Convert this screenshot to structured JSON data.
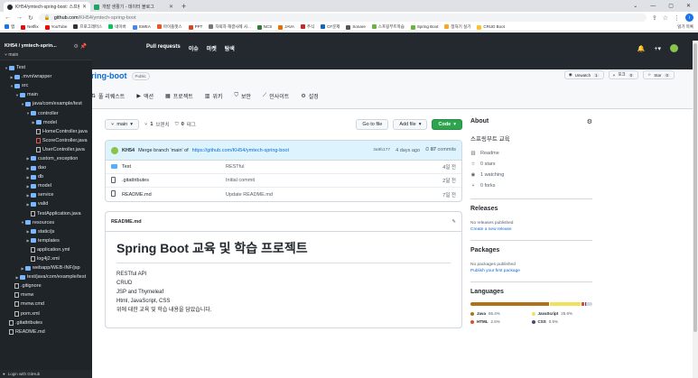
{
  "browser": {
    "tabs": [
      {
        "title": "KH54/ymtech-spring-boot: 스프링...",
        "active": true,
        "icon": "github-icon"
      },
      {
        "title": "개발 생활기 - 데이터 블로그",
        "active": false,
        "icon": "blog-icon"
      }
    ],
    "url_host": "github.com",
    "url_path": "/KH54/ymtech-spring-boot",
    "profile_initial": "i",
    "bookmarks": [
      "앱",
      "Netflix",
      "YouTube",
      "프로그래머스",
      "네이버",
      "SWEA",
      "마이플랫스",
      "PPT",
      "자퇴자 해결사례 사...",
      "NCS",
      "JAVA",
      "주식",
      "CF문제",
      "Sonare",
      "스프링부트학습",
      "Spring Boot",
      "정처기 실기",
      "CRUD Boot"
    ],
    "bookmarks_right": "읽기 목록"
  },
  "github": {
    "nav": [
      "Pull requests",
      "이슈",
      "마켓",
      "탐색"
    ],
    "repo_name": "ring-boot",
    "visibility": "Public",
    "watch": {
      "label": "Unwatch",
      "count": "1"
    },
    "fork": {
      "label": "포크",
      "count": "0"
    },
    "star": {
      "label": "Star",
      "count": "0"
    },
    "tabs": [
      "풀 리퀘스트",
      "액션",
      "프로젝트",
      "위키",
      "보안",
      "인사이트",
      "설정"
    ]
  },
  "sidebar": {
    "repo": "KH54 / ymtech-sprin...",
    "branch": "main",
    "footer": "Login with GitHub",
    "tree": [
      {
        "name": "Test",
        "depth": 0,
        "type": "folder",
        "open": true
      },
      {
        "name": ".mvn/wrapper",
        "depth": 1,
        "type": "folder",
        "open": false
      },
      {
        "name": "src",
        "depth": 1,
        "type": "folder",
        "open": true
      },
      {
        "name": "main",
        "depth": 2,
        "type": "folder",
        "open": true
      },
      {
        "name": "java/com/example/test",
        "depth": 3,
        "type": "folder",
        "open": true
      },
      {
        "name": "controller",
        "depth": 4,
        "type": "folder",
        "open": true
      },
      {
        "name": "model",
        "depth": 5,
        "type": "folder",
        "open": false
      },
      {
        "name": "HomeController.java",
        "depth": 5,
        "type": "file"
      },
      {
        "name": "ScoreController.java",
        "depth": 5,
        "type": "ctl"
      },
      {
        "name": "UserController.java",
        "depth": 5,
        "type": "file"
      },
      {
        "name": "custom_exception",
        "depth": 4,
        "type": "folder",
        "open": false
      },
      {
        "name": "dao",
        "depth": 4,
        "type": "folder",
        "open": false
      },
      {
        "name": "db",
        "depth": 4,
        "type": "folder",
        "open": false
      },
      {
        "name": "model",
        "depth": 4,
        "type": "folder",
        "open": false
      },
      {
        "name": "service",
        "depth": 4,
        "type": "folder",
        "open": false
      },
      {
        "name": "valid",
        "depth": 4,
        "type": "folder",
        "open": false
      },
      {
        "name": "TestApplication.java",
        "depth": 4,
        "type": "file"
      },
      {
        "name": "resources",
        "depth": 3,
        "type": "folder",
        "open": true
      },
      {
        "name": "static/js",
        "depth": 4,
        "type": "folder",
        "open": false
      },
      {
        "name": "templates",
        "depth": 4,
        "type": "folder",
        "open": false
      },
      {
        "name": "application.yml",
        "depth": 4,
        "type": "file"
      },
      {
        "name": "log4j2.xml",
        "depth": 4,
        "type": "file"
      },
      {
        "name": "webapp/WEB-INF/jsp",
        "depth": 3,
        "type": "folder",
        "open": false
      },
      {
        "name": "test/java/com/example/test",
        "depth": 2,
        "type": "folder",
        "open": false
      },
      {
        "name": ".gitignore",
        "depth": 1,
        "type": "file"
      },
      {
        "name": "mvnw",
        "depth": 1,
        "type": "file"
      },
      {
        "name": "mvnw.cmd",
        "depth": 1,
        "type": "file"
      },
      {
        "name": "pom.xml",
        "depth": 1,
        "type": "file"
      },
      {
        "name": ".gitattributes",
        "depth": 0,
        "type": "file"
      },
      {
        "name": "README.md",
        "depth": 0,
        "type": "file"
      }
    ]
  },
  "toolbar": {
    "branch": "main",
    "branches_count": "1",
    "branches_label": "브랜치",
    "tags_count": "0",
    "tags_label": "태그",
    "goto": "Go to file",
    "addfile": "Add file",
    "code": "Code"
  },
  "commit": {
    "author": "KH54",
    "message": "Merge branch 'main' of",
    "link": "https://github.com/KH54/ymtech-spring-boot",
    "hash": "3a0b177",
    "time": "4 days ago",
    "commits_count": "87",
    "commits_label": "commits"
  },
  "files": [
    {
      "name": "Test",
      "type": "folder",
      "message": "RESTful",
      "age": "4일 전"
    },
    {
      "name": ".gitattributes",
      "type": "file",
      "message": "Initial commit",
      "age": "2달 전"
    },
    {
      "name": "README.md",
      "type": "file",
      "message": "Update README.md",
      "age": "7일 전"
    }
  ],
  "readme": {
    "filename": "README.md",
    "title": "Spring Boot 교육 및 학습 프로젝트",
    "lines": [
      "RESTful API",
      "CRUD",
      "JSP and Thymeleaf",
      "Html, JavaScript, CSS",
      "위에 대한 교육 및 학습 내용을 담았습니다."
    ]
  },
  "about": {
    "title": "About",
    "description": "스프링부트 교육",
    "readme": "Readme",
    "stars": "0 stars",
    "watching": "1 watching",
    "forks": "0 forks"
  },
  "releases": {
    "title": "Releases",
    "none": "No releases published",
    "link": "Create a new release"
  },
  "packages": {
    "title": "Packages",
    "none": "No packages published",
    "link": "Publish your first package"
  },
  "languages": {
    "title": "Languages",
    "items": [
      {
        "name": "Java",
        "percent": "66.4%",
        "value": 66.4,
        "color": "#b07219"
      },
      {
        "name": "JavaScript",
        "percent": "25.6%",
        "value": 25.6,
        "color": "#f1e05a"
      },
      {
        "name": "HTML",
        "percent": "2.5%",
        "value": 2.5,
        "color": "#e34c26"
      },
      {
        "name": "CSS",
        "percent": "0.5%",
        "value": 0.5,
        "color": "#563d7c"
      }
    ]
  }
}
